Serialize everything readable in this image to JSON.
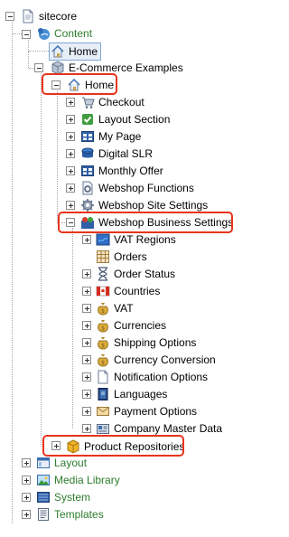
{
  "root": {
    "label": "sitecore",
    "icon": "document-icon"
  },
  "content": {
    "label": "Content",
    "icon": "globe-people-icon",
    "color": "#2d7d2d"
  },
  "home_top": {
    "label": "Home",
    "icon": "home-icon"
  },
  "ecommerce": {
    "label": "E-Commerce Examples",
    "icon": "package-icon"
  },
  "home": {
    "label": "Home",
    "icon": "home-icon"
  },
  "home_children": [
    {
      "label": "Checkout",
      "icon": "cart-icon"
    },
    {
      "label": "Layout Section",
      "icon": "checkmark-doc-icon"
    },
    {
      "label": "My Page",
      "icon": "grid-page-icon"
    },
    {
      "label": "Digital SLR",
      "icon": "camera-icon"
    },
    {
      "label": "Monthly Offer",
      "icon": "grid-page-icon"
    },
    {
      "label": "Webshop Functions",
      "icon": "page-gear-icon"
    },
    {
      "label": "Webshop Site Settings",
      "icon": "gear-icon"
    }
  ],
  "business_settings": {
    "label": "Webshop Business Settings",
    "icon": "people-settings-icon"
  },
  "business_children": [
    {
      "label": "VAT Regions",
      "icon": "map-icon"
    },
    {
      "label": "Orders",
      "icon": "table-icon"
    },
    {
      "label": "Order Status",
      "icon": "hourglass-icon"
    },
    {
      "label": "Countries",
      "icon": "flag-canada-icon"
    },
    {
      "label": "VAT",
      "icon": "money-bag-icon"
    },
    {
      "label": "Currencies",
      "icon": "money-bag-icon"
    },
    {
      "label": "Shipping Options",
      "icon": "money-bag-icon"
    },
    {
      "label": "Currency Conversion",
      "icon": "money-bag-icon"
    },
    {
      "label": "Notification Options",
      "icon": "page-icon"
    },
    {
      "label": "Languages",
      "icon": "book-icon"
    },
    {
      "label": "Payment Options",
      "icon": "envelope-pay-icon"
    },
    {
      "label": "Company Master Data",
      "icon": "company-icon"
    }
  ],
  "product_repos": {
    "label": "Product Repositories",
    "icon": "cube-icon"
  },
  "bottom": [
    {
      "label": "Layout",
      "icon": "layout-icon",
      "color": "#2d7d2d"
    },
    {
      "label": "Media Library",
      "icon": "image-icon",
      "color": "#2d7d2d"
    },
    {
      "label": "System",
      "icon": "system-icon",
      "color": "#2d7d2d"
    },
    {
      "label": "Templates",
      "icon": "templates-icon",
      "color": "#2d7d2d"
    }
  ],
  "colors": {
    "highlight": "#e8331c",
    "section_green": "#2d7d2d",
    "connector": "#a8a8a8"
  }
}
